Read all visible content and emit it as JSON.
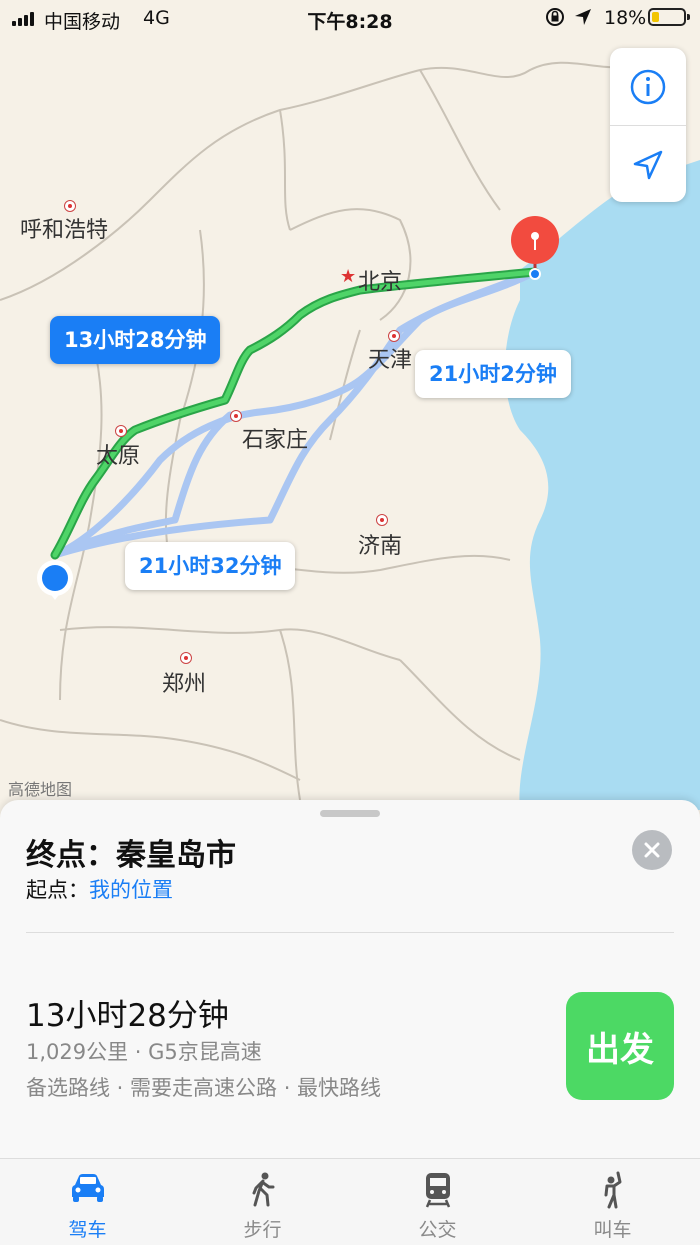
{
  "status_bar": {
    "carrier": "中国移动",
    "network": "4G",
    "time": "下午8:28",
    "battery_percent": "18%"
  },
  "map_controls": {
    "info_icon": "info-icon",
    "location_icon": "location-arrow-icon"
  },
  "map": {
    "cities": {
      "hohhot": "呼和浩特",
      "beijing": "北京",
      "tianjin": "天津",
      "taiyuan": "太原",
      "shijiazhuang": "石家庄",
      "jinan": "济南",
      "zhengzhou": "郑州"
    },
    "route_callouts": {
      "primary": "13小时28分钟",
      "alt1": "21小时2分钟",
      "alt2": "21小时32分钟"
    },
    "watermark": "高德地图",
    "colors": {
      "primary_route": "#3ac05a",
      "alt_route": "#aac6f2",
      "sea": "#a9dcf2",
      "land": "#f6f1e7"
    }
  },
  "sheet": {
    "destination_label": "终点：",
    "destination": "秦皇岛市",
    "origin_label": "起点：",
    "origin": "我的位置",
    "route_time": "13小时28分钟",
    "route_distance": "1,029公里 · G5京昆高速",
    "route_notes": "备选路线 · 需要走高速公路 · 最快路线",
    "go_label": "出发"
  },
  "tabs": [
    {
      "label": "驾车",
      "icon": "car-icon",
      "active": true
    },
    {
      "label": "步行",
      "icon": "walk-icon",
      "active": false
    },
    {
      "label": "公交",
      "icon": "train-icon",
      "active": false
    },
    {
      "label": "叫车",
      "icon": "ride-hail-icon",
      "active": false
    }
  ]
}
